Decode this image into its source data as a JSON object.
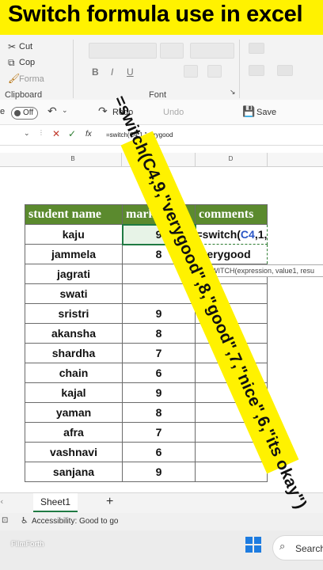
{
  "title": "Switch formula use in excel",
  "ribbon": {
    "cut": "Cut",
    "copy": "Cop",
    "format_painter": "Forma",
    "clipboard_label": "Clipboard",
    "font_label": "Font",
    "bold": "B",
    "italic": "I",
    "underline": "U"
  },
  "qat": {
    "autosave": "Off",
    "redo": "Redo",
    "undo_sub": "Undo",
    "save": "Save"
  },
  "formula_bar": {
    "content": "=switch(C4,1,\"verygood"
  },
  "columns": [
    "B",
    "C",
    "D"
  ],
  "table": {
    "headers": [
      "student name",
      "marks",
      "comments"
    ],
    "rows": [
      {
        "name": "kaju",
        "marks": "9"
      },
      {
        "name": "jammela",
        "marks": "8"
      },
      {
        "name": "jagrati",
        "marks": ""
      },
      {
        "name": "swati",
        "marks": ""
      },
      {
        "name": "sristri",
        "marks": "9"
      },
      {
        "name": "akansha",
        "marks": "8"
      },
      {
        "name": "shardha",
        "marks": "7"
      },
      {
        "name": "chain",
        "marks": "6"
      },
      {
        "name": "kajal",
        "marks": "9"
      },
      {
        "name": "yaman",
        "marks": "8"
      },
      {
        "name": "afra",
        "marks": "7"
      },
      {
        "name": "vashnavi",
        "marks": "6"
      },
      {
        "name": "sanjana",
        "marks": "9"
      }
    ],
    "editing_line1_pre": "=switch(",
    "editing_ref": "C4",
    "editing_line1_post": ",1,",
    "editing_line2": "\"verygood"
  },
  "tooltip": "SWITCH(expression, value1, resu",
  "sheet_tab": "Sheet1",
  "add_sheet": "+",
  "status": "Accessibility: Good to go",
  "taskbar": {
    "search": "Search",
    "watermark": "FilmForth"
  },
  "annotation": "=switch(C4,9,\"verygood\",8,\"good\",7,\"nice\",6,\"its okay\")",
  "colors": {
    "banner": "#fff200",
    "header_fill": "#5b8a2e",
    "selection": "#1f7a43"
  }
}
